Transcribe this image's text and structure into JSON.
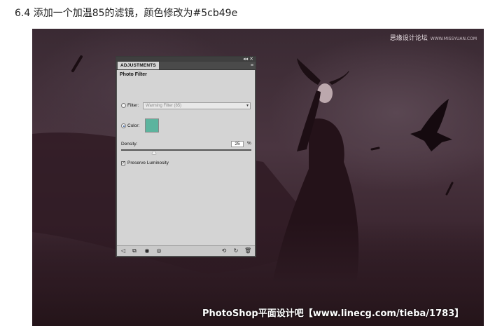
{
  "caption": "6.4 添加一个加温85的滤镜，颜色修改为#5cb49e",
  "scene": {
    "watermark_top": "思缘设计论坛",
    "watermark_top_small": "WWW.MISSYUAN.COM",
    "watermark_bottom": "PhotoShop平面设计吧【www.linecg.com/tieba/1783】"
  },
  "panel": {
    "top_controls": "◂◂ ✕",
    "tab_label": "ADJUSTMENTS",
    "menu_icon": "≡",
    "heading": "Photo Filter",
    "filter_label": "Filter:",
    "filter_value": "Warming Filter (85)",
    "filter_arrow": "▾",
    "color_label": "Color:",
    "color_hex": "#5cb49e",
    "density_label": "Density:",
    "density_value": "25",
    "density_unit": "%",
    "density_fraction": 0.25,
    "check_mark": "✓",
    "preserve_label": "Preserve Luminosity",
    "bottom_icons": {
      "back": "◁",
      "clip": "⧉",
      "visibility": "◉",
      "eye": "◎",
      "previous_state": "⟲",
      "reset": "↻",
      "delete": "🗑"
    }
  },
  "colors": {
    "swatch": "#5cb49e",
    "panel_bg": "#d4d4d4",
    "panel_frame": "#535353"
  }
}
